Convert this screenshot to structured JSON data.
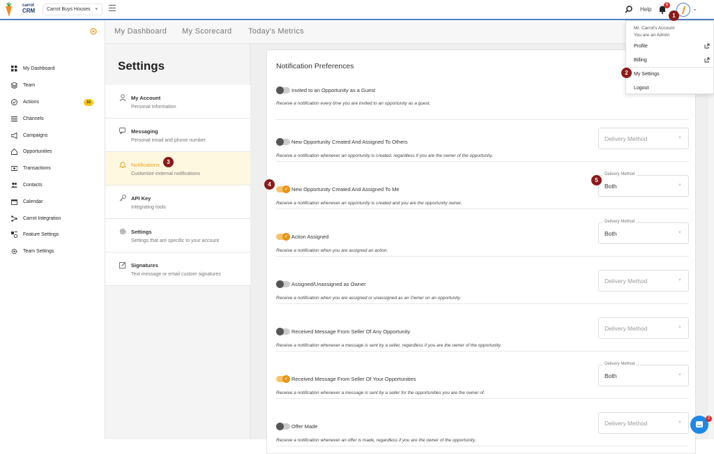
{
  "topbar": {
    "logo_line1": "carrot",
    "logo_line2": "CRM",
    "company": "Carrot Buys Houses",
    "help": "Help",
    "notif_count": "6",
    "chat_count": "2"
  },
  "sidebar": {
    "items": [
      {
        "label": "My Dashboard",
        "icon": "grid-icon"
      },
      {
        "label": "Team",
        "icon": "stack-icon"
      },
      {
        "label": "Actions",
        "icon": "check-circle-icon",
        "badge": "16"
      },
      {
        "label": "Channels",
        "icon": "list-icon"
      },
      {
        "label": "Campaigns",
        "icon": "megaphone-icon"
      },
      {
        "label": "Opportunities",
        "icon": "home-icon"
      },
      {
        "label": "Transactions",
        "icon": "money-icon"
      },
      {
        "label": "Contacts",
        "icon": "people-icon"
      },
      {
        "label": "Calendar",
        "icon": "calendar-icon"
      },
      {
        "label": "Carrot Integration",
        "icon": "integration-icon"
      },
      {
        "label": "Feature Settings",
        "icon": "feature-icon"
      },
      {
        "label": "Team Settings",
        "icon": "gear-icon"
      }
    ]
  },
  "tabs": [
    "My Dashboard",
    "My Scorecard",
    "Today's Metrics"
  ],
  "settings": {
    "title": "Settings",
    "menu": [
      {
        "title": "My Account",
        "sub": "Personal Information",
        "icon": "user-icon"
      },
      {
        "title": "Messaging",
        "sub": "Personal email and phone number",
        "icon": "chat-icon"
      },
      {
        "title": "Notifications",
        "sub": "Customize external notifications",
        "icon": "bell-icon",
        "active": true
      },
      {
        "title": "API Key",
        "sub": "Integrating tools",
        "icon": "key-icon"
      },
      {
        "title": "Settings",
        "sub": "Settings that are specific to your account",
        "icon": "gear-icon"
      },
      {
        "title": "Signatures",
        "sub": "Text message or email custom signatures",
        "icon": "edit-icon"
      }
    ]
  },
  "notifications": {
    "title": "Notification Preferences",
    "caption": "Delivery Method",
    "placeholder": "Delivery Method",
    "prefs": [
      {
        "label": "Invited to an Opportunity as a Guest",
        "desc": "Receive a notification every time you are invited to an opportunity as a guest.",
        "on": false,
        "method": null
      },
      {
        "label": "New Opportunity Created And Assigned To Others",
        "desc": "Receive a notification whenever an opportunity is created, regardless if you are the owner of the opportunity.",
        "on": false,
        "method": ""
      },
      {
        "label": "New Opportunity Created And Assigned To Me",
        "desc": "Receive a notification whenever an opportunity is created and you are the opportunity owner.",
        "on": true,
        "method": "Both"
      },
      {
        "label": "Action Assigned",
        "desc": "Receive a notification when you are assigned an action.",
        "on": true,
        "method": "Both"
      },
      {
        "label": "Assigned/Unassigned as Owner",
        "desc": "Receive a notification when you are assigned or unassigned as an Owner on an opportunity.",
        "on": false,
        "method": ""
      },
      {
        "label": "Received Message From Seller Of Any Opportunity",
        "desc": "Receive a notification whenever a message is sent by a seller, regardless if you are the owner of the opportunity.",
        "on": false,
        "method": ""
      },
      {
        "label": "Received Message From Seller Of Your Opportunities",
        "desc": "Receive a notification whenever a message is sent by a seller for the opportunities you are the owner of.",
        "on": true,
        "method": "Both"
      },
      {
        "label": "Offer Made",
        "desc": "Receive a notification whenever an offer is made, regardless if you are the owner of the opportunity.",
        "on": false,
        "method": ""
      }
    ]
  },
  "account_menu": {
    "header_line1": "Mr. Carrot's Account",
    "header_line2": "You are an Admin",
    "items": [
      "Profile",
      "Billing",
      "My Settings",
      "Logout"
    ]
  },
  "markers": [
    "1",
    "2",
    "3",
    "4",
    "5"
  ],
  "colors": {
    "accent": "#e8941a",
    "brand_blue": "#4e7fc3",
    "marker": "#8b1a1a"
  }
}
